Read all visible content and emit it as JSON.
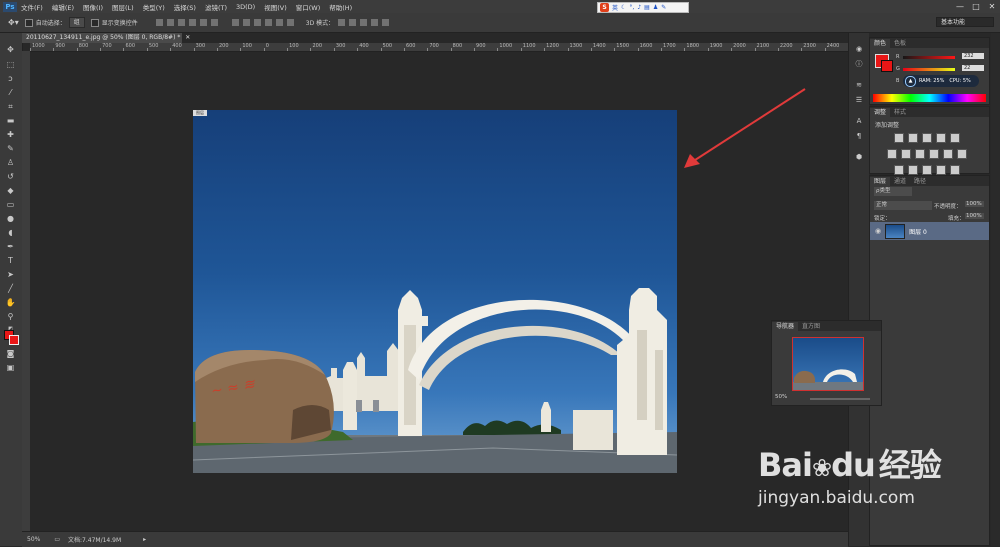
{
  "app": {
    "logo": "Ps"
  },
  "menu": [
    "文件(F)",
    "编辑(E)",
    "图像(I)",
    "图层(L)",
    "类型(Y)",
    "选择(S)",
    "滤镜(T)",
    "3D(D)",
    "视图(V)",
    "窗口(W)",
    "帮助(H)"
  ],
  "ime": {
    "brand": "S",
    "label": "英"
  },
  "window_controls": [
    "—",
    "□",
    "✕"
  ],
  "options": {
    "auto_select_label": "自动选择：",
    "auto_select_value": "组",
    "transform_label": "显示变换控件",
    "mode_3d": "3D 模式：",
    "workspace": "基本功能"
  },
  "document": {
    "tab_title": "20110627_134911_e.jpg @ 50% (图层 0, RGB/8#) *",
    "layer_tag": "图层",
    "zoom": "50%",
    "doc_info": "文档:7.47M/14.9M",
    "ruler_labels": [
      "1000",
      "900",
      "800",
      "700",
      "600",
      "500",
      "400",
      "300",
      "200",
      "100",
      "0",
      "100",
      "200",
      "300",
      "400",
      "500",
      "600",
      "700",
      "800",
      "900",
      "1000",
      "1100",
      "1200",
      "1300",
      "1400",
      "1500",
      "1600",
      "1700",
      "1800",
      "1900",
      "2000",
      "2100",
      "2200",
      "2300",
      "2400"
    ]
  },
  "color_panel": {
    "tabs": [
      "颜色",
      "色板"
    ],
    "r_label": "R",
    "r_value": "232",
    "g_label": "G",
    "g_value": "22",
    "b_label": "B",
    "ram": "RAM: 25%",
    "cpu": "CPU: 5%"
  },
  "adjust_panel": {
    "tabs": [
      "调整",
      "样式"
    ],
    "title": "添加调整"
  },
  "layers_panel": {
    "tabs": [
      "图层",
      "通道",
      "路径"
    ],
    "kind": "ρ类型",
    "blend": "正常",
    "opacity_label": "不透明度：",
    "opacity_value": "100%",
    "lock_label": "锁定：",
    "fill_label": "填充：",
    "fill_value": "100%",
    "layer_name": "图层 0"
  },
  "navigator": {
    "tabs": [
      "导航器",
      "直方图"
    ],
    "zoom": "50%"
  },
  "watermark": {
    "brand": "Bai",
    "brand_tail": "du",
    "cn": "经验",
    "url": "jingyan.baidu.com"
  },
  "colors": {
    "foreground": "#e81616",
    "background": "#ffffff",
    "sky": "#1f5697",
    "arrow": "#e03a3a"
  }
}
